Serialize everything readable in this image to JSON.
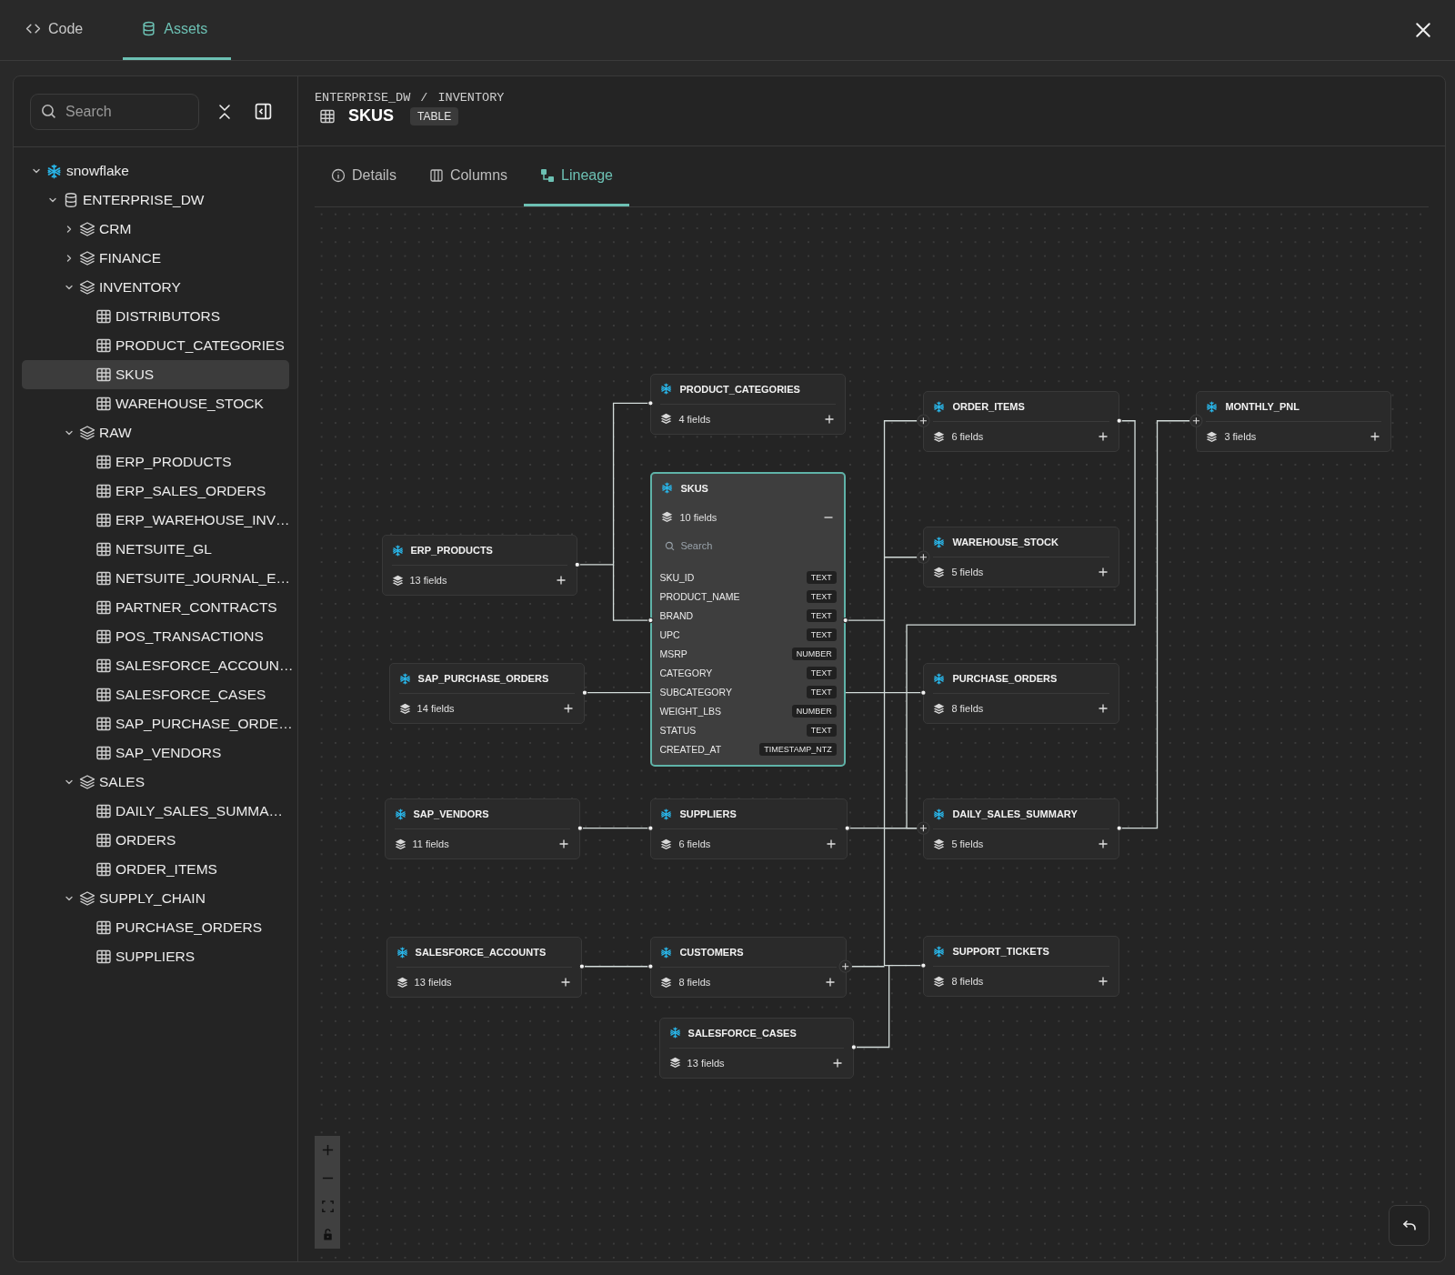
{
  "top_tabs": [
    {
      "label": "Code",
      "selected": false
    },
    {
      "label": "Assets",
      "selected": true
    }
  ],
  "sidebar": {
    "search": {
      "placeholder": "Search"
    },
    "tree": [
      {
        "label": "snowflake",
        "kind": "source",
        "expanded": true,
        "selected": false,
        "children": [
          {
            "label": "ENTERPRISE_DW",
            "kind": "database",
            "expanded": true,
            "selected": false,
            "children": [
              {
                "label": "CRM",
                "kind": "schema",
                "expanded": false,
                "selected": false
              },
              {
                "label": "FINANCE",
                "kind": "schema",
                "expanded": false,
                "selected": false
              },
              {
                "label": "INVENTORY",
                "kind": "schema",
                "expanded": true,
                "selected": false,
                "children": [
                  {
                    "label": "DISTRIBUTORS",
                    "kind": "table",
                    "selected": false
                  },
                  {
                    "label": "PRODUCT_CATEGORIES",
                    "kind": "table",
                    "selected": false
                  },
                  {
                    "label": "SKUS",
                    "kind": "table",
                    "selected": true
                  },
                  {
                    "label": "WAREHOUSE_STOCK",
                    "kind": "table",
                    "selected": false
                  }
                ]
              },
              {
                "label": "RAW",
                "kind": "schema",
                "expanded": true,
                "selected": false,
                "children": [
                  {
                    "label": "ERP_PRODUCTS",
                    "kind": "table",
                    "selected": false
                  },
                  {
                    "label": "ERP_SALES_ORDERS",
                    "kind": "table",
                    "selected": false
                  },
                  {
                    "label": "ERP_WAREHOUSE_INV…",
                    "kind": "table",
                    "selected": false
                  },
                  {
                    "label": "NETSUITE_GL",
                    "kind": "table",
                    "selected": false
                  },
                  {
                    "label": "NETSUITE_JOURNAL_E…",
                    "kind": "table",
                    "selected": false
                  },
                  {
                    "label": "PARTNER_CONTRACTS",
                    "kind": "table",
                    "selected": false
                  },
                  {
                    "label": "POS_TRANSACTIONS",
                    "kind": "table",
                    "selected": false
                  },
                  {
                    "label": "SALESFORCE_ACCOUN…",
                    "kind": "table",
                    "selected": false
                  },
                  {
                    "label": "SALESFORCE_CASES",
                    "kind": "table",
                    "selected": false
                  },
                  {
                    "label": "SAP_PURCHASE_ORDE…",
                    "kind": "table",
                    "selected": false
                  },
                  {
                    "label": "SAP_VENDORS",
                    "kind": "table",
                    "selected": false
                  }
                ]
              },
              {
                "label": "SALES",
                "kind": "schema",
                "expanded": true,
                "selected": false,
                "children": [
                  {
                    "label": "DAILY_SALES_SUMMA…",
                    "kind": "table",
                    "selected": false
                  },
                  {
                    "label": "ORDERS",
                    "kind": "table",
                    "selected": false
                  },
                  {
                    "label": "ORDER_ITEMS",
                    "kind": "table",
                    "selected": false
                  }
                ]
              },
              {
                "label": "SUPPLY_CHAIN",
                "kind": "schema",
                "expanded": true,
                "selected": false,
                "children": [
                  {
                    "label": "PURCHASE_ORDERS",
                    "kind": "table",
                    "selected": false
                  },
                  {
                    "label": "SUPPLIERS",
                    "kind": "table",
                    "selected": false
                  }
                ]
              }
            ]
          }
        ]
      }
    ]
  },
  "header": {
    "breadcrumb": [
      "ENTERPRISE_DW",
      "/",
      "INVENTORY"
    ],
    "title": "SKUS",
    "badge": "TABLE"
  },
  "detail_tabs": [
    {
      "label": "Details",
      "selected": false
    },
    {
      "label": "Columns",
      "selected": false
    },
    {
      "label": "Lineage",
      "selected": true
    }
  ],
  "lineage": {
    "nodes": [
      {
        "name": "PRODUCT_CATEGORIES",
        "fields_count": "4 fields",
        "selected": false,
        "expanded": false
      },
      {
        "name": "ORDER_ITEMS",
        "fields_count": "6 fields",
        "selected": false,
        "expanded": false
      },
      {
        "name": "MONTHLY_PNL",
        "fields_count": "3 fields",
        "selected": false,
        "expanded": false
      },
      {
        "name": "SKUS",
        "fields_count": "10 fields",
        "selected": true,
        "expanded": true,
        "search": {
          "placeholder": "Search"
        },
        "fields": [
          {
            "name": "SKU_ID",
            "type": "TEXT"
          },
          {
            "name": "PRODUCT_NAME",
            "type": "TEXT"
          },
          {
            "name": "BRAND",
            "type": "TEXT"
          },
          {
            "name": "UPC",
            "type": "TEXT"
          },
          {
            "name": "MSRP",
            "type": "NUMBER"
          },
          {
            "name": "CATEGORY",
            "type": "TEXT"
          },
          {
            "name": "SUBCATEGORY",
            "type": "TEXT"
          },
          {
            "name": "WEIGHT_LBS",
            "type": "NUMBER"
          },
          {
            "name": "STATUS",
            "type": "TEXT"
          },
          {
            "name": "CREATED_AT",
            "type": "TIMESTAMP_NTZ"
          }
        ]
      },
      {
        "name": "WAREHOUSE_STOCK",
        "fields_count": "5 fields",
        "selected": false,
        "expanded": false
      },
      {
        "name": "ERP_PRODUCTS",
        "fields_count": "13 fields",
        "selected": false,
        "expanded": false
      },
      {
        "name": "SAP_PURCHASE_ORDERS",
        "fields_count": "14 fields",
        "selected": false,
        "expanded": false
      },
      {
        "name": "PURCHASE_ORDERS",
        "fields_count": "8 fields",
        "selected": false,
        "expanded": false
      },
      {
        "name": "SAP_VENDORS",
        "fields_count": "11 fields",
        "selected": false,
        "expanded": false
      },
      {
        "name": "SUPPLIERS",
        "fields_count": "6 fields",
        "selected": false,
        "expanded": false
      },
      {
        "name": "DAILY_SALES_SUMMARY",
        "fields_count": "5 fields",
        "selected": false,
        "expanded": false
      },
      {
        "name": "SALESFORCE_ACCOUNTS",
        "fields_count": "13 fields",
        "selected": false,
        "expanded": false
      },
      {
        "name": "CUSTOMERS",
        "fields_count": "8 fields",
        "selected": false,
        "expanded": false
      },
      {
        "name": "SUPPORT_TICKETS",
        "fields_count": "8 fields",
        "selected": false,
        "expanded": false
      },
      {
        "name": "SALESFORCE_CASES",
        "fields_count": "13 fields",
        "selected": false,
        "expanded": false
      }
    ]
  }
}
